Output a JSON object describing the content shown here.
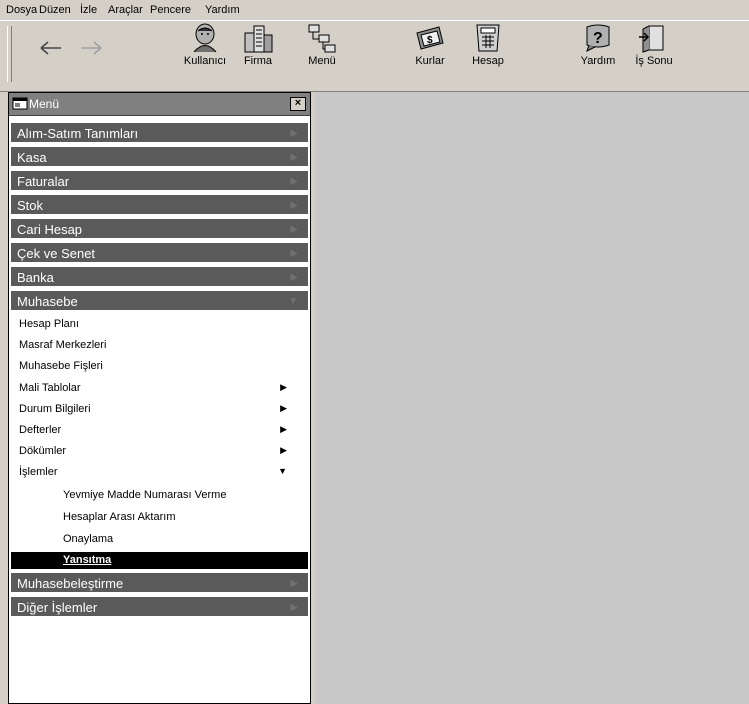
{
  "menubar": {
    "items": [
      "Dosya",
      "Düzen",
      "İzle",
      "Araçlar",
      "Pencere",
      "Yardım"
    ]
  },
  "toolbar": {
    "back_icon": "arrow-left-icon",
    "forward_icon": "arrow-right-icon",
    "buttons": [
      {
        "label": "Kullanıcı",
        "icon": "user-icon"
      },
      {
        "label": "Firma",
        "icon": "building-icon"
      },
      {
        "label": "Menü",
        "icon": "menu-tree-icon"
      },
      {
        "label": "Kurlar",
        "icon": "money-icon"
      },
      {
        "label": "Hesap",
        "icon": "calculator-icon"
      },
      {
        "label": "Yardım",
        "icon": "help-icon"
      },
      {
        "label": "İş Sonu",
        "icon": "exit-door-icon"
      }
    ]
  },
  "panel": {
    "title": "Menü",
    "close_label": "×",
    "categories": [
      "Alım-Satım Tanımları",
      "Kasa",
      "Faturalar",
      "Stok",
      "Cari Hesap",
      "Çek ve Senet",
      "Banka",
      "Muhasebe"
    ],
    "muhasebe_items": [
      "Hesap Planı",
      "Masraf Merkezleri",
      "Muhasebe Fişleri",
      "Mali Tablolar",
      "Durum Bilgileri",
      "Defterler",
      "Dökümler",
      "İşlemler"
    ],
    "islemler_items": [
      "Yevmiye Madde Numarası Verme",
      "Hesaplar Arası Aktarım",
      "Onaylama"
    ],
    "selected_item": "Yansıtma",
    "bottom_categories": [
      "Muhasebeleştirme",
      "Diğer İşlemler"
    ]
  }
}
